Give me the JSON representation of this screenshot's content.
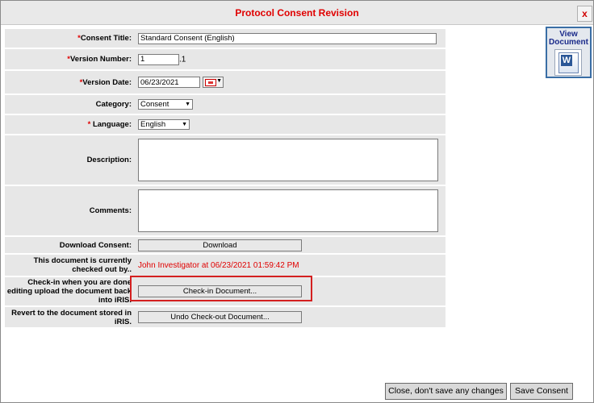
{
  "dialog": {
    "title": "Protocol Consent Revision",
    "close_label": "x"
  },
  "form": {
    "consent_title": {
      "label": "Consent Title:",
      "required_mark": "*",
      "value": "Standard Consent (English)"
    },
    "version_number": {
      "label": "Version Number:",
      "required_mark": "*",
      "value": "1",
      "suffix": ".1"
    },
    "version_date": {
      "label": "Version Date:",
      "required_mark": "*",
      "value": "06/23/2021"
    },
    "category": {
      "label": "Category:",
      "selected": "Consent"
    },
    "language": {
      "label": " Language:",
      "required_mark": "*",
      "selected": "English"
    },
    "description": {
      "label": "Description:",
      "value": ""
    },
    "comments": {
      "label": "Comments:",
      "value": ""
    },
    "download": {
      "label": "Download Consent:",
      "button": "Download"
    },
    "checked_out": {
      "label": "This document is currently checked out by..",
      "value": "John Investigator at 06/23/2021 01:59:42 PM"
    },
    "checkin": {
      "label": "Check-in when you are done editing upload the document back into iRIS.",
      "button": "Check-in Document..."
    },
    "revert": {
      "label": "Revert to the document stored in iRIS.",
      "button": "Undo Check-out Document..."
    }
  },
  "view_document": {
    "label": "View Document",
    "icon": "word-document-icon",
    "icon_letter": "W"
  },
  "footer": {
    "close_no_save": "Close, don't save any changes",
    "save": "Save Consent"
  },
  "colors": {
    "required": "#e00000",
    "title": "#e00000",
    "highlight": "#d42020"
  }
}
